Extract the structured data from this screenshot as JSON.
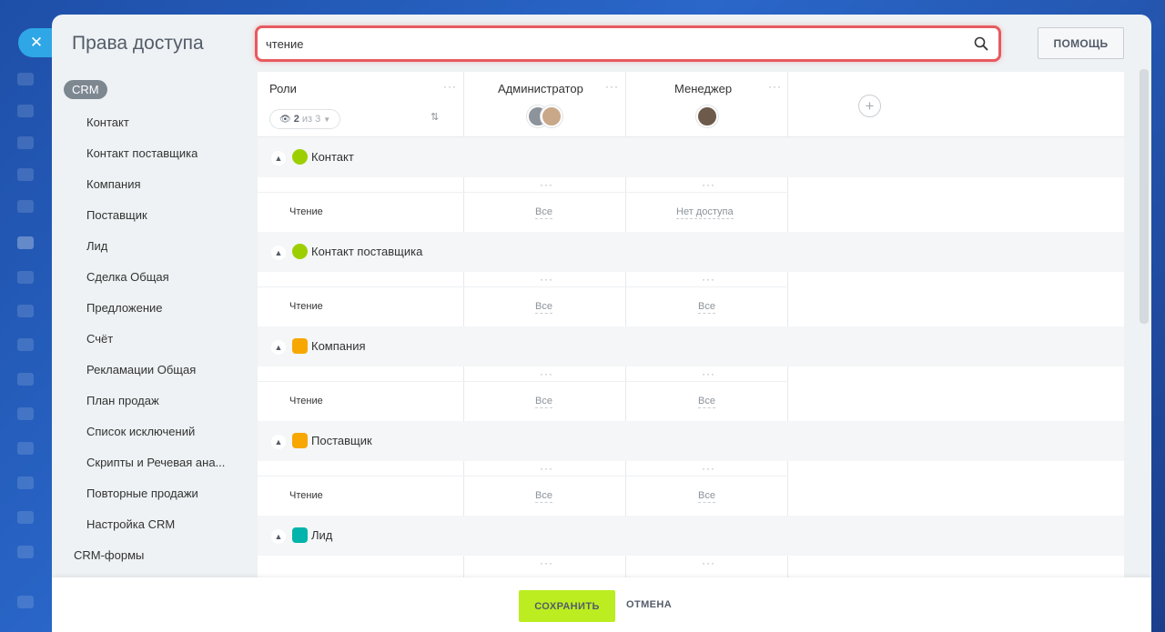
{
  "page": {
    "title": "Права доступа"
  },
  "search": {
    "value": "чтение"
  },
  "help_label": "ПОМОЩЬ",
  "sidebar": {
    "crm_label": "CRM",
    "items": [
      "Контакт",
      "Контакт поставщика",
      "Компания",
      "Поставщик",
      "Лид",
      "Сделка Общая",
      "Предложение",
      "Счёт",
      "Рекламации Общая",
      "План продаж",
      "Список исключений",
      "Скрипты и Речевая ана...",
      "Повторные продажи",
      "Настройка CRM"
    ],
    "crm_forms": "CRM-формы"
  },
  "header": {
    "roles_label": "Роли",
    "filter_count": "2",
    "filter_total": "из 3",
    "roles": [
      "Администратор",
      "Менеджер"
    ]
  },
  "groups": [
    {
      "label": "Контакт",
      "icon": "person-icon",
      "color": "#9dcf00",
      "row_label": "Чтение",
      "values": [
        "Все",
        "Нет доступа"
      ]
    },
    {
      "label": "Контакт поставщика",
      "icon": "person-icon",
      "color": "#9dcf00",
      "row_label": "Чтение",
      "values": [
        "Все",
        "Все"
      ]
    },
    {
      "label": "Компания",
      "icon": "building-icon",
      "color": "#f7a700",
      "row_label": "Чтение",
      "values": [
        "Все",
        "Все"
      ]
    },
    {
      "label": "Поставщик",
      "icon": "building-icon",
      "color": "#f7a700",
      "row_label": "Чтение",
      "values": [
        "Все",
        "Все"
      ]
    },
    {
      "label": "Лид",
      "icon": "card-icon",
      "color": "#00b4ac"
    }
  ],
  "footer": {
    "save_label": "СОХРАНИТЬ",
    "cancel_label": "ОТМЕНА"
  }
}
